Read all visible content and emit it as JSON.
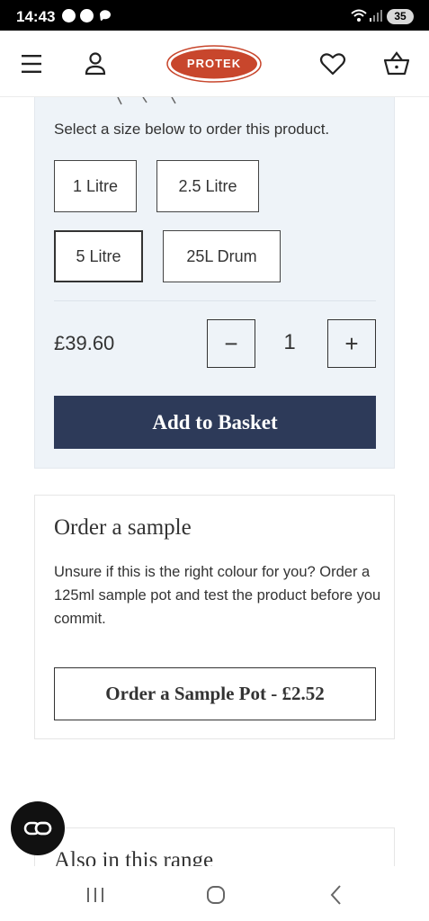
{
  "status_bar": {
    "time": "14:43",
    "battery": "35",
    "icons": [
      "notification-icon",
      "notification-icon",
      "chat-icon",
      "wifi-icon",
      "signal-icon",
      "battery-icon"
    ]
  },
  "header": {
    "logo_text": "PROTEK",
    "brand_color": "#c8462c",
    "icons": [
      "menu-icon",
      "account-icon",
      "heart-icon",
      "basket-icon"
    ]
  },
  "product_options": {
    "select_prompt": "Select a size below to order this product.",
    "sizes": [
      {
        "label": "1 Litre",
        "selected": false
      },
      {
        "label": "2.5 Litre",
        "selected": false
      },
      {
        "label": "5 Litre",
        "selected": true
      },
      {
        "label": "25L Drum",
        "selected": false
      }
    ],
    "price": "£39.60",
    "quantity": "1",
    "decrement_label": "−",
    "increment_label": "+",
    "add_to_basket_label": "Add to Basket",
    "accent_color": "#2d3a59"
  },
  "sample": {
    "title": "Order a sample",
    "description": "Unsure if this is the right colour for you? Order a 125ml sample pot and test the product before you commit.",
    "button_label": "Order a Sample Pot - £2.52"
  },
  "range": {
    "title": "Also in this range"
  },
  "cookie_button": {
    "icon": "cookie-settings-icon"
  },
  "nav_bar": {
    "icons": [
      "recent-apps-icon",
      "home-icon",
      "back-icon"
    ]
  }
}
